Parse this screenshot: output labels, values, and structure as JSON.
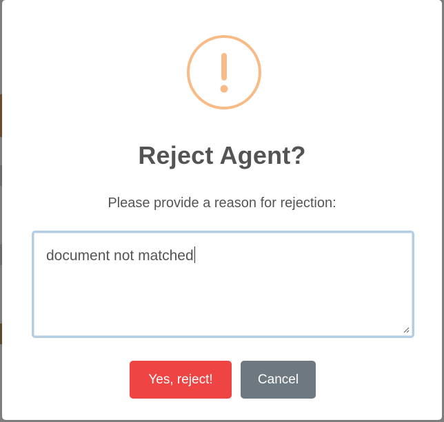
{
  "dialog": {
    "icon": "warning-exclamation-icon",
    "title": "Reject Agent?",
    "message": "Please provide a reason for rejection:",
    "reason_value": "document not matched",
    "confirm_label": "Yes, reject!",
    "cancel_label": "Cancel"
  },
  "colors": {
    "warning_icon": "#f8bb86",
    "confirm_button": "#ef4444",
    "cancel_button": "#6e7881",
    "input_focus_border": "#b3cde3",
    "title_text": "#545454"
  }
}
